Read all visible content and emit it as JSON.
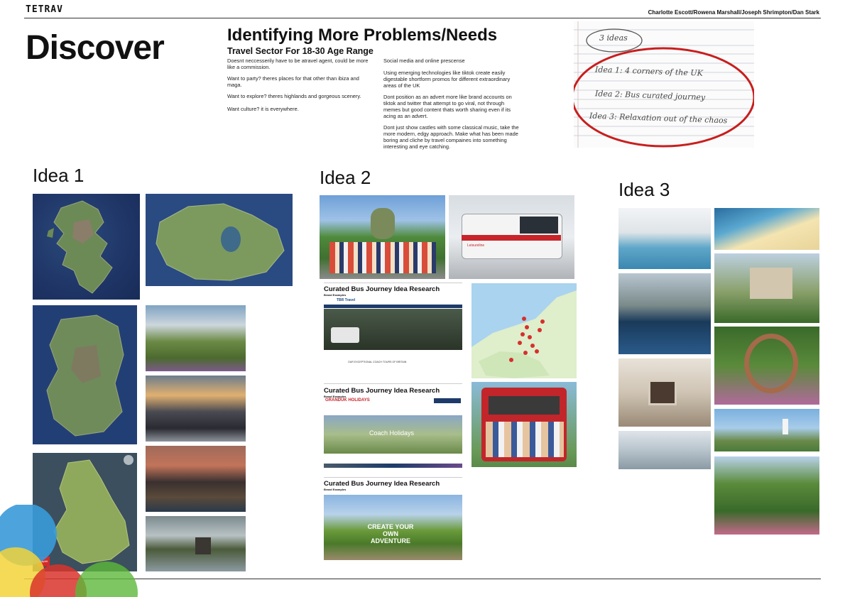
{
  "header": {
    "brand": "TETRAV",
    "authors": "Charlotte Escott/Rowena Marshall/Joseph Shrimpton/Dan Stark"
  },
  "page_title": "Discover",
  "problems": {
    "title": "Identifying More Problems/Needs",
    "subtitle": "Travel Sector For 18-30 Age Range",
    "left_col": [
      "Doesnt neccesserily have to be atravel agent, could be more like a commission.",
      "Want to party? theres places for that other than ibiza and maga.",
      "Want to explore? theres highlands and gorgeous scenery.",
      "Want culture? it is everywhere."
    ],
    "right_col": [
      "Social media and online prescense",
      "Using emerging technologies like tiktok create easily digestable shortform promos for different extraordinary areas of the UK",
      "Dont position as an advert more like brand accounts on tiktok and twitter that attempt to go viral, not through memes but good content thats worth sharing even if its acing as an advert.",
      "Dont just show castles with some classical music, take the more modern, edgy approach. Make what has been made boring and cliche by travel compaines into something interesting and eye catching."
    ]
  },
  "notes": {
    "heading": "3 ideas",
    "items": [
      "Idea 1: 4 corners of the UK",
      "Idea 2: Bus curated journey",
      "Idea 3: Relaxation out of the chaos"
    ]
  },
  "idea1": {
    "label": "Idea 1",
    "map_logo": "mapbit"
  },
  "idea2": {
    "label": "Idea 2",
    "coach_brand": "Leisureline",
    "research": [
      {
        "title": "Curated Bus Journey Idea Research",
        "sub": "Brand Examples",
        "brand": "TBR Travel",
        "hero": "",
        "footer": "OUR EXCEPTIONAL COACH TOURS OF BRITAIN"
      },
      {
        "title": "Curated Bus Journey Idea Research",
        "sub": "Brand Examples",
        "brand": "GRANDUK HOLIDAYS",
        "hero": "Coach Holidays",
        "footer": ""
      },
      {
        "title": "Curated Bus Journey Idea Research",
        "sub": "Brand Examples",
        "brand": "",
        "hero": "CREATE YOUR OWN ADVENTURE",
        "footer": ""
      }
    ]
  },
  "idea3": {
    "label": "Idea 3"
  },
  "colors": {
    "circle_blue": "#3a9ad9",
    "circle_yellow": "#f2d43a",
    "circle_red": "#d9342b",
    "circle_green": "#5cb83a",
    "ink_red": "#c81e1e"
  }
}
